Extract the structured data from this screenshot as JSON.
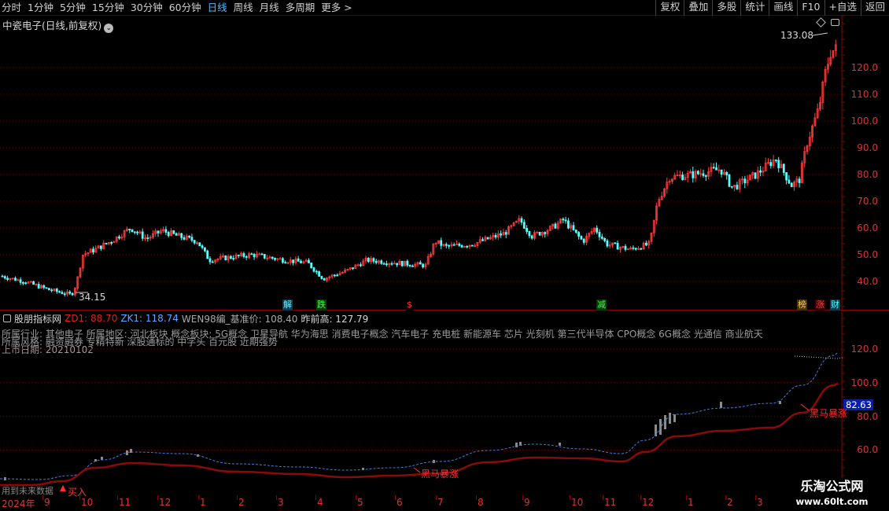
{
  "toolbar": {
    "periods": [
      "分时",
      "1分钟",
      "5分钟",
      "15分钟",
      "30分钟",
      "60分钟",
      "日线",
      "周线",
      "月线",
      "多周期",
      "更多 >"
    ],
    "active_period": "日线",
    "tools": [
      "复权",
      "叠加",
      "多股",
      "统计",
      "画线",
      "F10",
      "+自选",
      "返回"
    ]
  },
  "stock": {
    "title": "中瓷电子(日线,前复权)"
  },
  "main_chart": {
    "price_ticks": [
      "120.0",
      "110.0",
      "100.0",
      "90.0",
      "80.0",
      "70.0",
      "60.0",
      "50.0",
      "40.0"
    ],
    "high_label": "133.08",
    "low_label": "34.15",
    "up_color": "#ff3a3a",
    "down_color": "#54ffff",
    "events": [
      {
        "label": "解",
        "color": "#54ffff",
        "bg": "#0b3a52"
      },
      {
        "label": "跌",
        "color": "#3cff3c",
        "bg": "#0a3a0a"
      },
      {
        "label": "$",
        "color": "#ff3030",
        "bg": "#000000"
      },
      {
        "label": "减",
        "color": "#3cff3c",
        "bg": "#0a3a0a"
      },
      {
        "label": "榜",
        "color": "#ffd040",
        "bg": "#4a3000"
      },
      {
        "label": "涨",
        "color": "#ff4040",
        "bg": "#3a0000"
      },
      {
        "label": "财",
        "color": "#54ffff",
        "bg": "#0b3a52"
      }
    ]
  },
  "indicator": {
    "name": "股朋指标网",
    "zd1": "ZD1: 88.70",
    "zk1": "ZK1: 118.74",
    "wen": "WEN98编_基准价: 108.40",
    "prev_high": "昨前高: 127.79",
    "info_lines": [
      "所属行业:   其他电子     所属地区:    河北板块     概念板块:    5G概念 卫星导航 华为海思 消费电子概念 汽车电子 充电桩 新能源车 芯片 光刻机 第三代半导体 CPO概念 6G概念 光通信 商业航天",
      "所属风格: 融资融券 专精特新 深股通标的 中字头 百元股 近期强势",
      "上市日期: 20210102"
    ],
    "ticks": [
      "120.0",
      "100.0",
      "80.0",
      "60.0"
    ],
    "value_box": "82.63",
    "signals": [
      "黑马暴涨",
      "黑马暴涨"
    ],
    "buy_label": "买入"
  },
  "date_axis": {
    "year_label": "2024年",
    "months": [
      "9",
      "10",
      "11",
      "12",
      "1",
      "2",
      "3",
      "4",
      "5",
      "6",
      "7",
      "8",
      "9",
      "10",
      "11",
      "12",
      "1",
      "2",
      "3"
    ]
  },
  "footer": {
    "left_label": "用到未来数据"
  },
  "watermark": {
    "title": "乐淘公式网",
    "url": "www.60lt.com"
  }
}
